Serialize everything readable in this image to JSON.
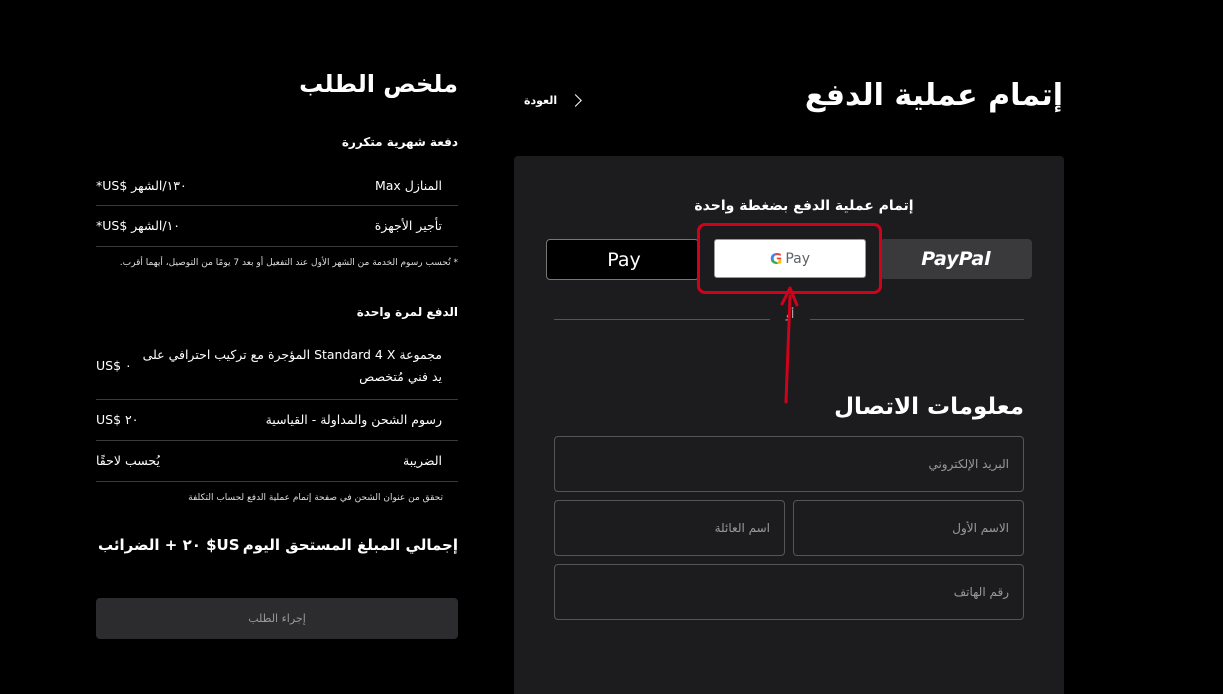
{
  "checkout": {
    "title": "إتمام عملية الدفع",
    "back_label": "العودة",
    "express_title": "إتمام عملية الدفع بضغطة واحدة",
    "apple_pay_label": "Pay",
    "google_pay_label": "Pay",
    "paypal_label": "PayPal",
    "divider_text": "أو",
    "contact_title": "معلومات الاتصال",
    "fields": {
      "email_placeholder": "البريد الإلكتروني",
      "first_name_placeholder": "الاسم الأول",
      "last_name_placeholder": "اسم العائلة",
      "phone_placeholder": "رقم الهاتف"
    }
  },
  "annotation": {
    "highlight_color": "#d0021b",
    "target": "google-pay-button"
  },
  "summary": {
    "title": "ملخص الطلب",
    "recurring_heading": "دفعة شهرية متكررة",
    "recurring_items": [
      {
        "label": "المنازل Max",
        "value": "*US$ ١٣٠/الشهر"
      },
      {
        "label": "تأجير الأجهزة",
        "value": "*US$ ١٠/الشهر"
      }
    ],
    "recurring_note": "* تُحسب رسوم الخدمة من الشهر الأول عند التفعيل أو بعد 7 يومًا من التوصيل، أيهما أقرب.",
    "one_time_heading": "الدفع لمرة واحدة",
    "one_time_items": [
      {
        "label": "مجموعة Standard 4 X المؤجرة مع تركيب احترافي على يد فني مُتخصص",
        "value": "US$ ٠"
      },
      {
        "label": "رسوم الشحن والمداولة - القياسية",
        "value": "US$ ٢٠"
      },
      {
        "label": "الضريبة",
        "value": "يُحسب لاحقًا"
      }
    ],
    "shipping_note": "تحقق من عنوان الشحن في صفحة إتمام عملية الدفع لحساب التكلفة",
    "total_label": "إجمالي المبلغ المستحق اليوم",
    "total_value": "US$ ٢٠ + الضرائب",
    "place_order_label": "إجراء الطلب"
  }
}
